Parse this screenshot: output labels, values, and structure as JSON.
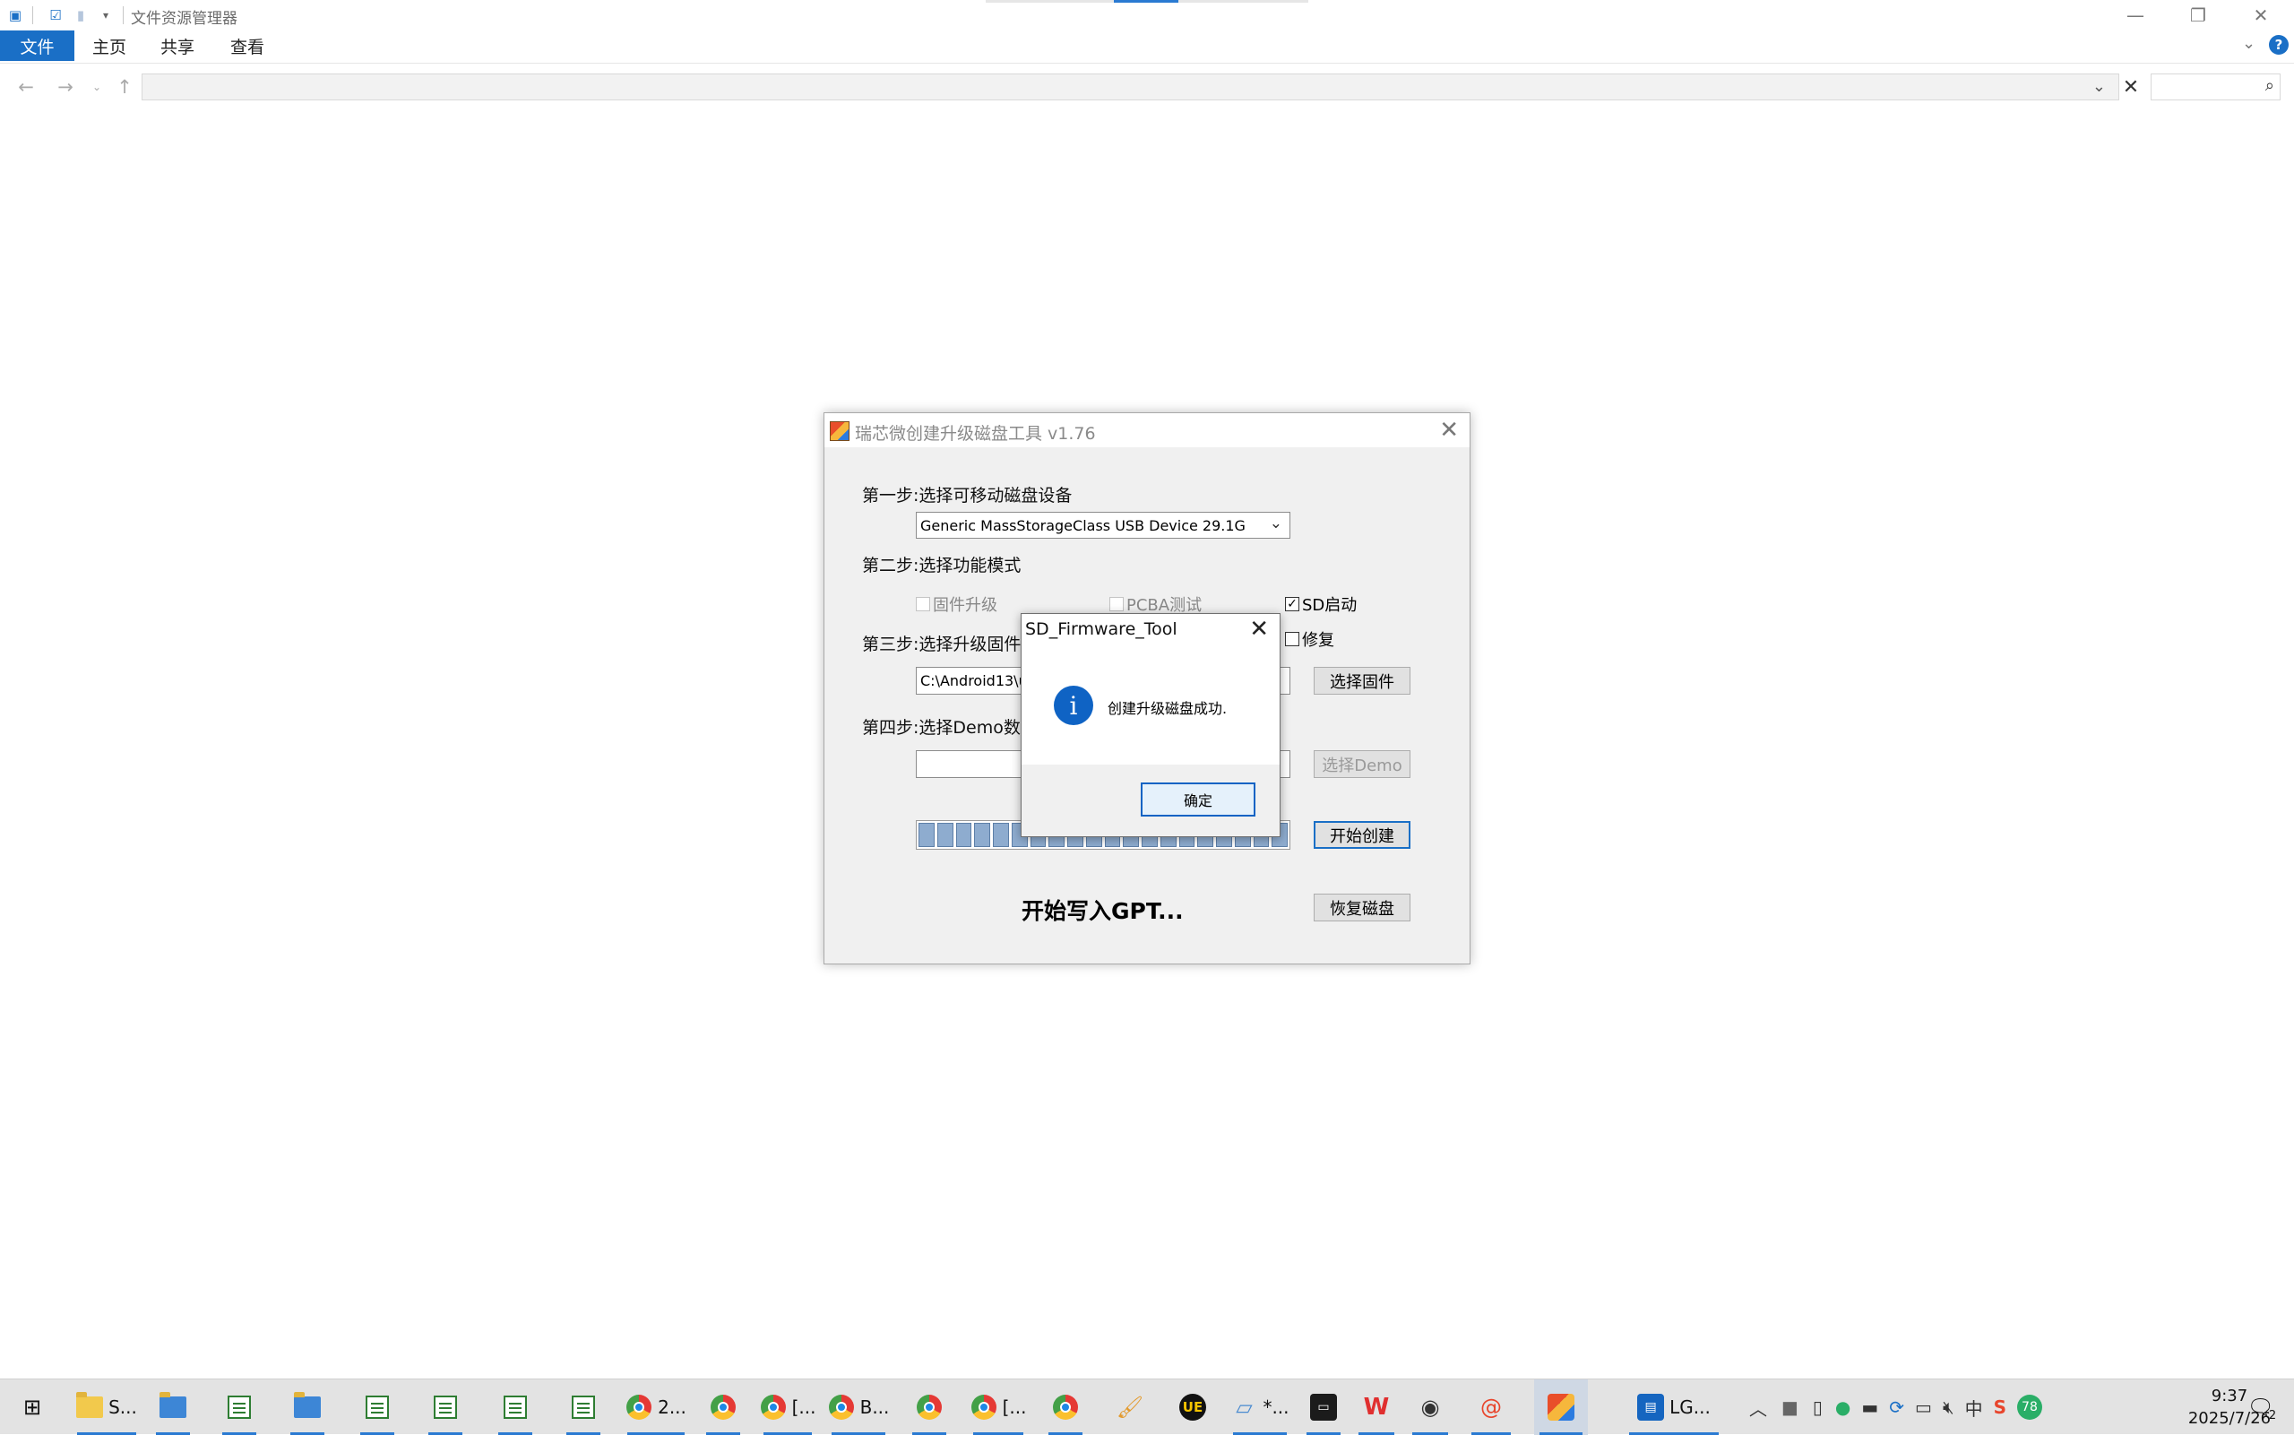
{
  "explorer": {
    "title": "文件资源管理器",
    "ribbon_tabs": [
      "文件",
      "主页",
      "共享",
      "查看"
    ],
    "help": "?",
    "address_value": "",
    "search_placeholder": ""
  },
  "tool": {
    "title": "瑞芯微创建升级磁盘工具 v1.76",
    "step1_label": "第一步:选择可移动磁盘设备",
    "device_selected": "Generic MassStorageClass USB Device   29.1G",
    "step2_label": "第二步:选择功能模式",
    "modes": [
      {
        "label": "固件升级",
        "checked": false,
        "enabled": false
      },
      {
        "label": "PCBA测试",
        "checked": false,
        "enabled": false
      },
      {
        "label": "SD启动",
        "checked": true,
        "enabled": true
      },
      {
        "label": "修复",
        "checked": false,
        "enabled": true
      }
    ],
    "step3_label": "第三步:选择升级固件",
    "firmware_path": "C:\\Android13\\u",
    "select_firmware_button": "选择固件",
    "step4_label": "第四步:选择Demo数据",
    "demo_path": "",
    "select_demo_button": "选择Demo",
    "start_button": "开始创建",
    "progress_fraction": 0.23,
    "progress_segments": 20,
    "status_text": "开始写入GPT...",
    "restore_button": "恢复磁盘"
  },
  "dialog": {
    "title": "SD_Firmware_Tool",
    "message": "创建升级磁盘成功.",
    "ok_button": "确定",
    "icon": "info-icon"
  },
  "taskbar": {
    "items": [
      {
        "name": "start-button",
        "icon": "windows-logo-icon",
        "label": ""
      },
      {
        "name": "taskbar-explorer-s",
        "icon": "folder-icon",
        "label": "S..."
      },
      {
        "name": "taskbar-explorer-2",
        "icon": "folder-icon",
        "label": ""
      },
      {
        "name": "taskbar-app-1",
        "icon": "document-icon",
        "label": ""
      },
      {
        "name": "taskbar-explorer-3",
        "icon": "folder-icon",
        "label": ""
      },
      {
        "name": "taskbar-app-2",
        "icon": "document-icon",
        "label": ""
      },
      {
        "name": "taskbar-app-3",
        "icon": "document-icon",
        "label": ""
      },
      {
        "name": "taskbar-app-4",
        "icon": "document-icon",
        "label": ""
      },
      {
        "name": "taskbar-app-5",
        "icon": "document-icon",
        "label": ""
      },
      {
        "name": "taskbar-chrome-1",
        "icon": "chrome-icon",
        "label": "2..."
      },
      {
        "name": "taskbar-chrome-2",
        "icon": "chrome-icon",
        "label": ""
      },
      {
        "name": "taskbar-chrome-3",
        "icon": "chrome-icon",
        "label": "[..."
      },
      {
        "name": "taskbar-chrome-4",
        "icon": "chrome-icon",
        "label": "B..."
      },
      {
        "name": "taskbar-chrome-5",
        "icon": "chrome-icon",
        "label": ""
      },
      {
        "name": "taskbar-chrome-6",
        "icon": "chrome-icon",
        "label": "[..."
      },
      {
        "name": "taskbar-chrome-7",
        "icon": "chrome-icon",
        "label": ""
      },
      {
        "name": "taskbar-paint",
        "icon": "paint-icon",
        "label": ""
      },
      {
        "name": "taskbar-ultraedit",
        "icon": "ultraedit-icon",
        "label": ""
      },
      {
        "name": "taskbar-notepad",
        "icon": "notepad-icon",
        "label": "*..."
      },
      {
        "name": "taskbar-terminal",
        "icon": "terminal-icon",
        "label": ""
      },
      {
        "name": "taskbar-wps",
        "icon": "wps-icon",
        "label": ""
      },
      {
        "name": "taskbar-capture",
        "icon": "camera-icon",
        "label": ""
      },
      {
        "name": "taskbar-swirl",
        "icon": "swirl-icon",
        "label": ""
      },
      {
        "name": "taskbar-rk-tool",
        "icon": "rk-tool-icon",
        "label": ""
      },
      {
        "name": "taskbar-lg",
        "icon": "lg-app-icon",
        "label": "LG..."
      }
    ],
    "tray_badge": "78",
    "ime": "中",
    "time": "9:37",
    "date": "2025/7/26",
    "notification_count": "2"
  }
}
